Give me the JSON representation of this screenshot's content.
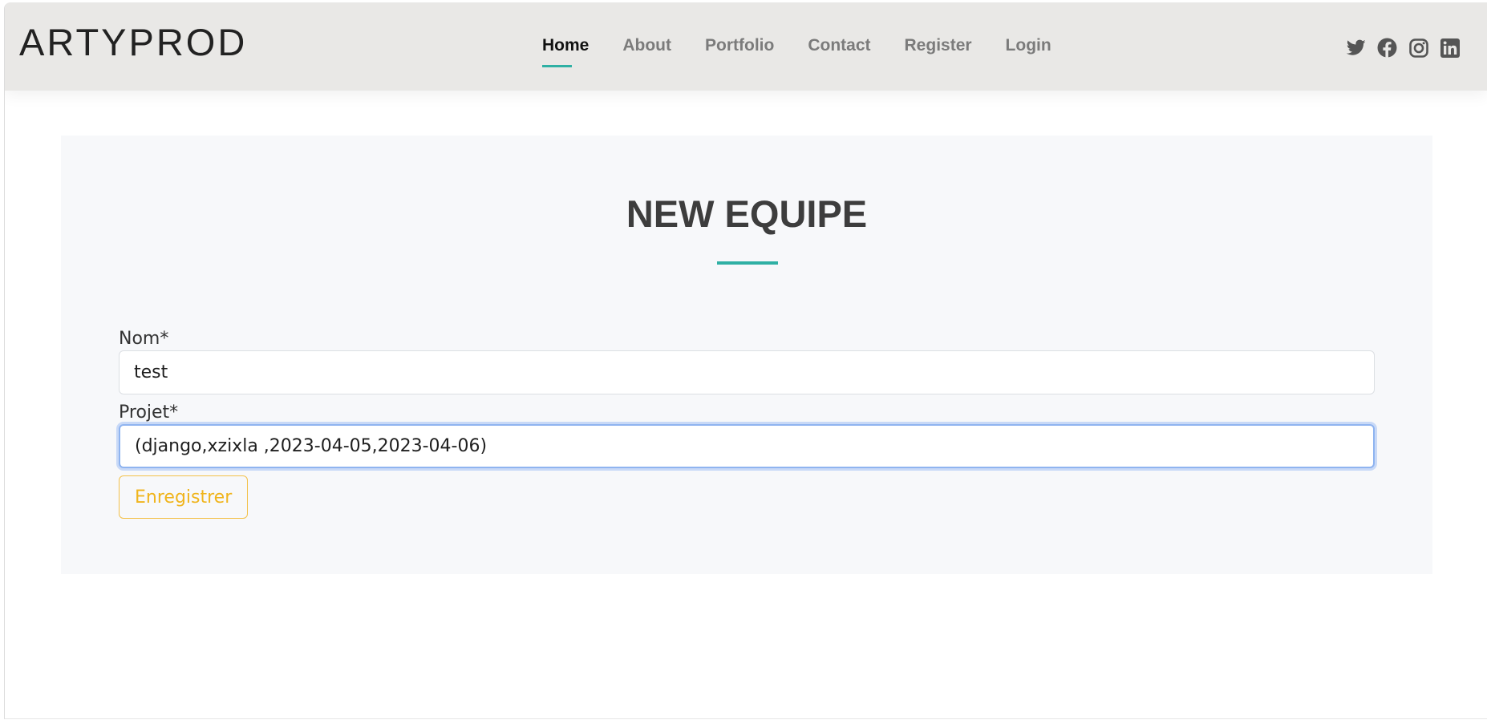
{
  "brand": {
    "logo": "ARTYPROD"
  },
  "nav": {
    "items": [
      {
        "label": "Home",
        "active": true
      },
      {
        "label": "About",
        "active": false
      },
      {
        "label": "Portfolio",
        "active": false
      },
      {
        "label": "Contact",
        "active": false
      },
      {
        "label": "Register",
        "active": false
      },
      {
        "label": "Login",
        "active": false
      }
    ]
  },
  "social": {
    "icons": [
      "twitter-icon",
      "facebook-icon",
      "instagram-icon",
      "linkedin-icon"
    ],
    "color": "#555555"
  },
  "page": {
    "title": "NEW EQUIPE"
  },
  "form": {
    "nom": {
      "label": "Nom*",
      "value": "test"
    },
    "projet": {
      "label": "Projet*",
      "value": "(django,xzixla ,2023-04-05,2023-04-06)"
    },
    "submit_label": "Enregistrer"
  },
  "colors": {
    "accent": "#2fb0a4",
    "button": "#f0b51d",
    "header_bg": "#e9e8e6",
    "card_bg": "#f7f8fa"
  }
}
